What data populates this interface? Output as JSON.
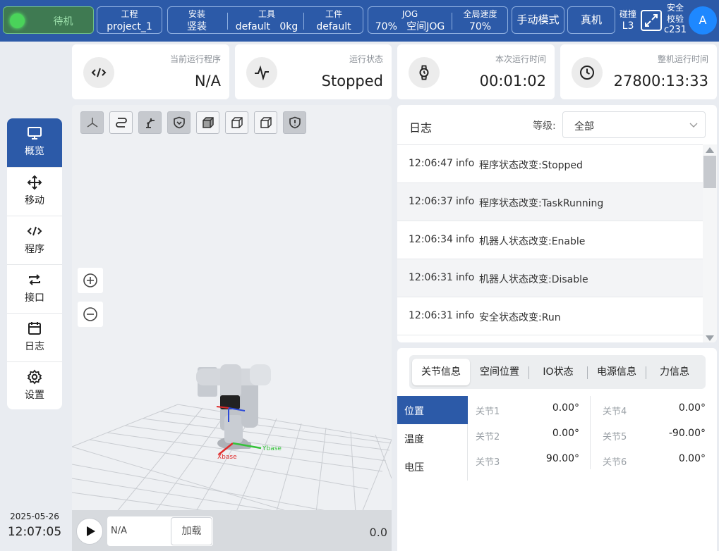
{
  "topbar": {
    "status": "待机",
    "project": {
      "label": "工程",
      "value": "project_1"
    },
    "install": {
      "label": "安装",
      "value": "竖装"
    },
    "tool": {
      "label": "工具",
      "name": "default",
      "weight": "0kg"
    },
    "workpiece": {
      "label": "工件",
      "value": "default"
    },
    "jog": {
      "label": "JOG",
      "speed": "70%",
      "mode": "空间JOG"
    },
    "global_speed": {
      "label": "全局速度",
      "value": "70%"
    },
    "manual_mode": "手动模式",
    "real_machine": "真机",
    "collision": {
      "label": "碰撞",
      "value": "L3"
    },
    "safety": {
      "line1": "安全",
      "line2": "校验",
      "value": "c231"
    },
    "avatar": "A"
  },
  "sidebar": {
    "items": [
      {
        "label": "概览",
        "icon": "monitor-icon"
      },
      {
        "label": "移动",
        "icon": "move-icon"
      },
      {
        "label": "程序",
        "icon": "code-icon"
      },
      {
        "label": "接口",
        "icon": "swap-icon"
      },
      {
        "label": "日志",
        "icon": "calendar-icon"
      },
      {
        "label": "设置",
        "icon": "gear-icon"
      }
    ],
    "date": "2025-05-26",
    "time": "12:07:05"
  },
  "cards": [
    {
      "label": "当前运行程序",
      "value": "N/A",
      "icon": "code-icon"
    },
    {
      "label": "运行状态",
      "value": "Stopped",
      "icon": "pulse-icon"
    },
    {
      "label": "本次运行时间",
      "value": "00:01:02",
      "icon": "watch-icon"
    },
    {
      "label": "整机运行时间",
      "value": "27800:13:33",
      "icon": "clock-icon"
    }
  ],
  "viewport": {
    "program_field": "N/A",
    "load_button": "加载",
    "value": "0.0",
    "axis_labels": {
      "x": "Xbase",
      "y": "Ybase"
    }
  },
  "log": {
    "title": "日志",
    "level_label": "等级:",
    "level_value": "全部",
    "rows": [
      {
        "time": "12:06:47",
        "level": "info",
        "message": "程序状态改变:Stopped"
      },
      {
        "time": "12:06:37",
        "level": "info",
        "message": "程序状态改变:TaskRunning"
      },
      {
        "time": "12:06:34",
        "level": "info",
        "message": "机器人状态改变:Enable"
      },
      {
        "time": "12:06:31",
        "level": "info",
        "message": "机器人状态改变:Disable"
      },
      {
        "time": "12:06:31",
        "level": "info",
        "message": "安全状态改变:Run"
      }
    ]
  },
  "joints": {
    "tabs": [
      "关节信息",
      "空间位置",
      "IO状态",
      "电源信息",
      "力信息"
    ],
    "subnav": [
      "位置",
      "温度",
      "电压"
    ],
    "values": [
      {
        "label": "关节1",
        "value": "0.00°"
      },
      {
        "label": "关节2",
        "value": "0.00°"
      },
      {
        "label": "关节3",
        "value": "90.00°"
      },
      {
        "label": "关节4",
        "value": "0.00°"
      },
      {
        "label": "关节5",
        "value": "-90.00°"
      },
      {
        "label": "关节6",
        "value": "0.00°"
      }
    ]
  },
  "colors": {
    "brand": "#2c5aa8",
    "status_green": "#4ad35a",
    "avatar": "#1e88ff"
  }
}
